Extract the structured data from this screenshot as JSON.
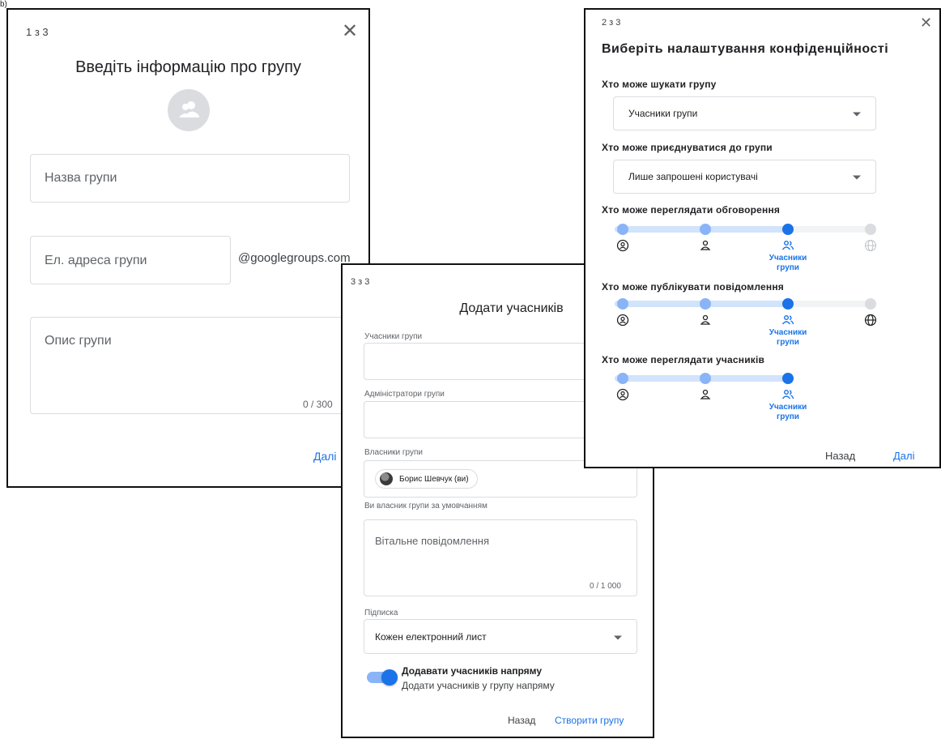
{
  "corner_text": "b)",
  "dialog1": {
    "step": "1 з 3",
    "title": "Введіть інформацію про групу",
    "name_placeholder": "Назва групи",
    "email_placeholder": "Ел. адреса групи",
    "email_domain": "@googlegroups.com",
    "description_placeholder": "Опис групи",
    "description_counter": "0 / 300",
    "next_label": "Далі"
  },
  "dialog2": {
    "step": "2 з 3",
    "title": "Виберіть налаштування конфіденційності",
    "search_label": "Хто може шукати групу",
    "search_value": "Учасники групи",
    "join_label": "Хто може приєднуватися до групи",
    "join_value": "Лише запрошені користувачі",
    "view_conversations_label": "Хто може переглядати обговорення",
    "view_conversations_selected": "Учасники групи",
    "post_label": "Хто може публікувати повідомлення",
    "post_selected": "Учасники групи",
    "view_members_label": "Хто може переглядати учасників",
    "view_members_selected": "Учасники групи",
    "selected_label_line1": "Учасники",
    "selected_label_line2": "групи",
    "back_label": "Назад",
    "next_label": "Далі",
    "levels": {
      "view_conversations": 3,
      "post": 3,
      "view_members": 3
    },
    "colors": {
      "accent": "#1a73e8",
      "track_active": "#d2e3fc",
      "dot_active": "#8ab4f8",
      "dot_inactive": "#dadce0"
    }
  },
  "dialog3": {
    "step": "3 з 3",
    "title": "Додати учасників",
    "members_label": "Учасники групи",
    "admins_label": "Адміністратори групи",
    "owners_label": "Власники групи",
    "owner_chip": "Борис Шевчук (ви)",
    "owner_note": "Ви власник групи за умовчанням",
    "welcome_placeholder": "Вітальне повідомлення",
    "welcome_counter": "0 / 1 000",
    "subscription_label": "Підписка",
    "subscription_value": "Кожен електронний лист",
    "toggle_title": "Додавати учасників напряму",
    "toggle_subtitle": "Додати учасників у групу напряму",
    "toggle_on": true,
    "back_label": "Назад",
    "create_label": "Створити групу"
  }
}
